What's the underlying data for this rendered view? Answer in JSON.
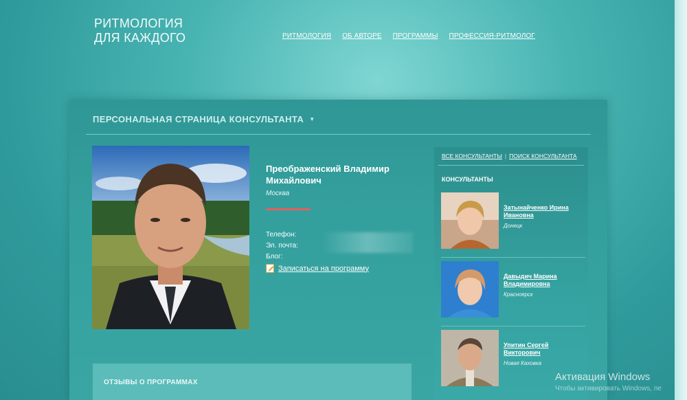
{
  "site": {
    "logo_line1": "РИТМОЛОГИЯ",
    "logo_line2": "ДЛЯ КАЖДОГО"
  },
  "nav": {
    "items": [
      {
        "label": "РИТМОЛОГИЯ"
      },
      {
        "label": "ОБ АВТОРЕ"
      },
      {
        "label": "ПРОГРАММЫ"
      },
      {
        "label": "ПРОФЕССИЯ-РИТМОЛОГ"
      }
    ]
  },
  "panel": {
    "title": "ПЕРСОНАЛЬНАЯ СТРАНИЦА КОНСУЛЬТАНТА",
    "caret_icon": "chevron-down-icon"
  },
  "consultant": {
    "name": "Преображенский Владимир Михайлович",
    "city": "Москва",
    "phone_label": "Телефон:",
    "email_label": "Эл. почта:",
    "blog_label": "Блог:",
    "signup_label": "Записаться на программу"
  },
  "reviews": {
    "title": "ОТЗЫВЫ О ПРОГРАММАХ"
  },
  "sidebar": {
    "link_all": "ВСЕ КОНСУЛЬТАНТЫ",
    "separator": "|",
    "link_search": "ПОИСК КОНСУЛЬТАНТА",
    "title": "КОНСУЛЬТАНТЫ",
    "consultants": [
      {
        "name": "Затынайченко Ирина Ивановна",
        "city": "Донецк"
      },
      {
        "name": "Давыдич Марина Владимировна",
        "city": "Красноярск"
      },
      {
        "name": "Упитин Сергей Викторович",
        "city": "Новая Каховка"
      }
    ]
  },
  "watermark": {
    "line1": "Активация Windows",
    "line2": "Чтобы активировать Windows, пе"
  },
  "colors": {
    "accent_red": "#e0605e",
    "panel_teal": "#2f9795"
  }
}
